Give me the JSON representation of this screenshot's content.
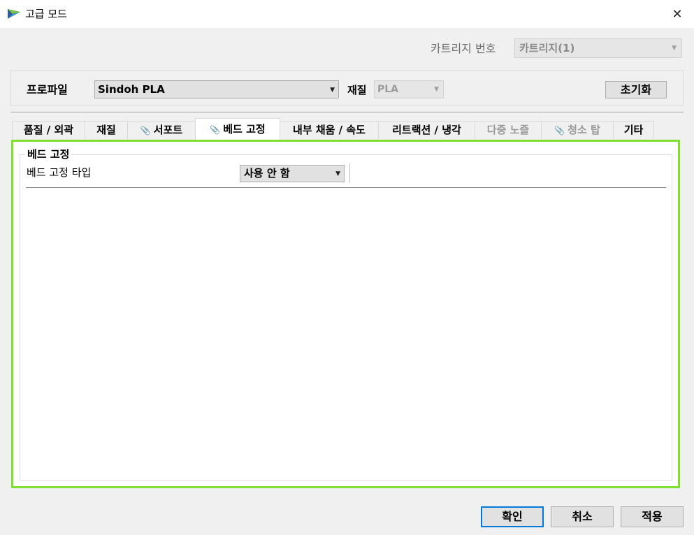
{
  "window": {
    "title": "고급 모드",
    "app_icon": "triangle-arrow-icon",
    "close_glyph": "✕"
  },
  "cartridge": {
    "label": "카트리지 번호",
    "value": "카트리지(1)"
  },
  "profile": {
    "label": "프로파일",
    "value": "Sindoh PLA",
    "material_label": "재질",
    "material_value": "PLA",
    "reset_label": "초기화"
  },
  "tabs": [
    {
      "label": "품질 / 외곽",
      "icon": "",
      "active": false,
      "disabled": false
    },
    {
      "label": "재질",
      "icon": "",
      "active": false,
      "disabled": false
    },
    {
      "label": "서포트",
      "icon": "paperclip-icon",
      "active": false,
      "disabled": false
    },
    {
      "label": "베드 고정",
      "icon": "paperclip-icon",
      "active": true,
      "disabled": false
    },
    {
      "label": "내부 채움 / 속도",
      "icon": "",
      "active": false,
      "disabled": false
    },
    {
      "label": "리트랙션 / 냉각",
      "icon": "",
      "active": false,
      "disabled": false
    },
    {
      "label": "다중 노즐",
      "icon": "",
      "active": false,
      "disabled": true
    },
    {
      "label": "청소 탑",
      "icon": "paperclip-icon",
      "active": false,
      "disabled": true
    },
    {
      "label": "기타",
      "icon": "",
      "active": false,
      "disabled": false
    }
  ],
  "bed_adhesion": {
    "group_title": "베드 고정",
    "type_label": "베드 고정 타입",
    "type_value": "사용 안 함"
  },
  "buttons": {
    "ok": "확인",
    "cancel": "취소",
    "apply": "적용"
  },
  "colors": {
    "highlight_border": "#80e030",
    "primary_border": "#0078d7"
  }
}
